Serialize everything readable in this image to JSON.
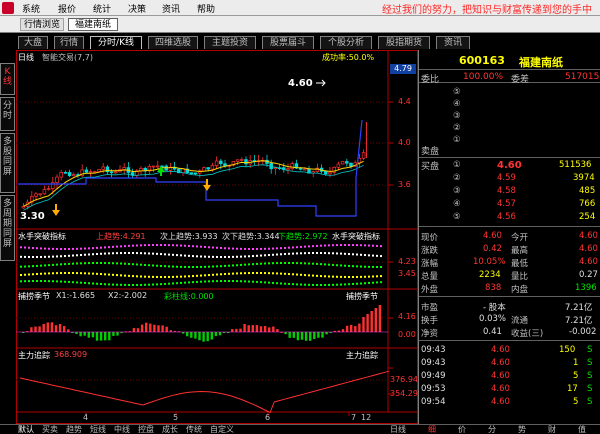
{
  "menu": {
    "items": [
      "系统",
      "报价",
      "统计",
      "决策",
      "资讯",
      "帮助"
    ],
    "slogan": "经过我们的努力，把知识与财富传递到您的手中"
  },
  "mode_tabs": [
    "行情浏览",
    "福建南纸"
  ],
  "sub_tabs": [
    "大盘",
    "行情",
    "分时/K线",
    "四维选股",
    "主题投资",
    "股票届斗",
    "个股分析",
    "股指期货",
    "资讯"
  ],
  "side_tabs": [
    "K线",
    "分时",
    "多股同屏",
    "多周期同屏"
  ],
  "main_panel": {
    "title": "日线",
    "indicator": "智能交易(7,7)",
    "overlay_right": "成功率:50.0%",
    "price_label": "4.60",
    "low_label": "3.30",
    "price_box": "4.79",
    "axis": [
      "4.4",
      "4.0",
      "3.6"
    ]
  },
  "panel2": {
    "name": "水手突破指标",
    "up_trend": "上趋势:4.291",
    "sub_up": "次上趋势:3.933",
    "sub_down": "次下趋势:3.344",
    "down_trend": "下趋势:2.972",
    "name_right": "水手突破指标",
    "axis": [
      "4.23",
      "3.45"
    ]
  },
  "panel3": {
    "name": "捕捞季节",
    "x1": "X1:-1.665",
    "x2": "X2:-2.002",
    "caiju": "彩柱线:0.000",
    "name_right": "捕捞季节",
    "axis": [
      "4.16",
      "0.00"
    ]
  },
  "panel4": {
    "name": "主力追踪",
    "value": "368.909",
    "name_right": "主力追踪",
    "axis": [
      "376.94",
      "354.29"
    ]
  },
  "date_axis": [
    "4",
    "5",
    "6",
    "7",
    "12"
  ],
  "bottom_tabs": [
    "默认",
    "买卖",
    "趋势",
    "短线",
    "中线",
    "控盘",
    "成长",
    "传统",
    "自定义"
  ],
  "bottom_right_tab": "日线",
  "quote": {
    "code": "600163",
    "name": "福建南纸",
    "weibi_label": "委比",
    "weibi": "100.00%",
    "weicha_label": "委差",
    "weicha": "517015",
    "sell_levels": [
      "⑤",
      "④",
      "③",
      "②",
      "①"
    ],
    "sell_label": "卖盘",
    "buy_label": "买盘",
    "buy": [
      {
        "lvl": "①",
        "price": "4.60",
        "vol": "511536"
      },
      {
        "lvl": "②",
        "price": "4.59",
        "vol": "3974"
      },
      {
        "lvl": "③",
        "price": "4.58",
        "vol": "485"
      },
      {
        "lvl": "④",
        "price": "4.57",
        "vol": "766"
      },
      {
        "lvl": "⑤",
        "price": "4.56",
        "vol": "254"
      }
    ],
    "stats": [
      {
        "l1": "现价",
        "v1": "4.60",
        "l2": "今开",
        "v2": "4.60"
      },
      {
        "l1": "涨跌",
        "v1": "0.42",
        "l2": "最高",
        "v2": "4.60"
      },
      {
        "l1": "涨幅",
        "v1": "10.05%",
        "l2": "最低",
        "v2": "4.60"
      },
      {
        "l1": "总量",
        "v1": "2234",
        "l2": "量比",
        "v2": "0.27"
      },
      {
        "l1": "外盘",
        "v1": "838",
        "l2": "内盘",
        "v2": "1396"
      }
    ],
    "stats2": [
      {
        "l1": "市盈",
        "v1": "- 股本",
        "v2": "7.21亿"
      },
      {
        "l1": "换手",
        "v1": "0.03%",
        "l2": "流通",
        "v2": "7.21亿"
      },
      {
        "l1": "净资",
        "v1": "0.41",
        "l2": "收益(三)",
        "v2": "-0.002"
      }
    ],
    "ticks": [
      {
        "t": "09:43",
        "p": "4.60",
        "v": "150",
        "s": "S"
      },
      {
        "t": "09:43",
        "p": "4.60",
        "v": "1",
        "s": "S"
      },
      {
        "t": "09:49",
        "p": "4.60",
        "v": "5",
        "s": "S"
      },
      {
        "t": "09:53",
        "p": "4.60",
        "v": "17",
        "s": "S"
      },
      {
        "t": "09:54",
        "p": "4.60",
        "v": "5",
        "s": "S"
      }
    ],
    "right_tabs": [
      "细",
      "价",
      "分",
      "势",
      "财",
      "值"
    ]
  }
}
